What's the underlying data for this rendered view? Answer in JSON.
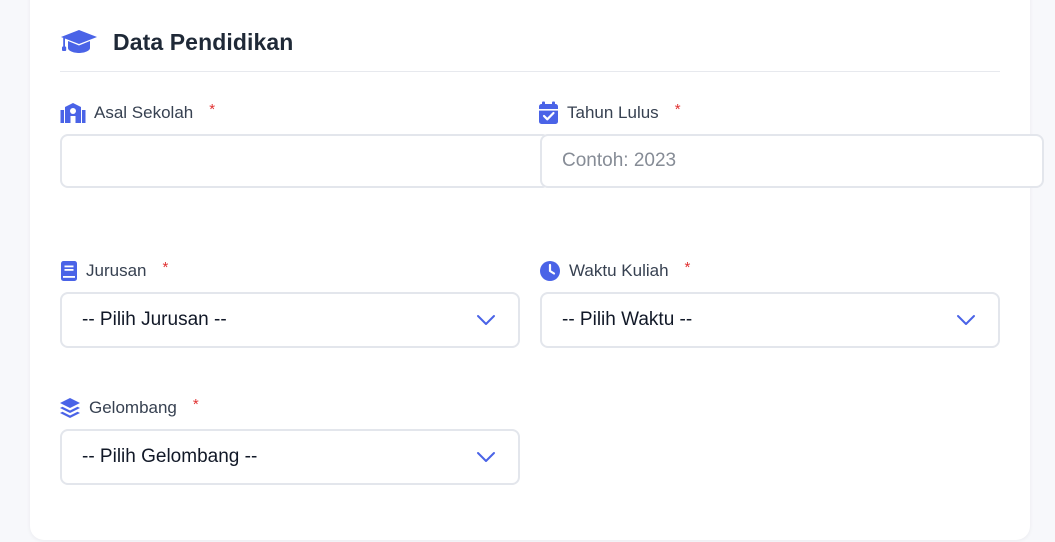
{
  "colors": {
    "accent": "#4a63e7",
    "required": "#e03131",
    "border": "#e3e6ec",
    "title": "#1f2937"
  },
  "section": {
    "title": "Data Pendidikan",
    "icon": "graduation-cap-icon"
  },
  "fields": {
    "asal_sekolah": {
      "label": "Asal Sekolah",
      "required_mark": "*",
      "icon": "school-icon",
      "value": "",
      "placeholder": ""
    },
    "tahun_lulus": {
      "label": "Tahun Lulus",
      "required_mark": "*",
      "icon": "calendar-check-icon",
      "value": "",
      "placeholder": "Contoh: 2023"
    },
    "jurusan": {
      "label": "Jurusan",
      "required_mark": "*",
      "icon": "book-icon",
      "selected": "-- Pilih Jurusan --"
    },
    "waktu_kuliah": {
      "label": "Waktu Kuliah",
      "required_mark": "*",
      "icon": "clock-icon",
      "selected": "-- Pilih Waktu --"
    },
    "gelombang": {
      "label": "Gelombang",
      "required_mark": "*",
      "icon": "layers-icon",
      "selected": "-- Pilih Gelombang --"
    }
  }
}
